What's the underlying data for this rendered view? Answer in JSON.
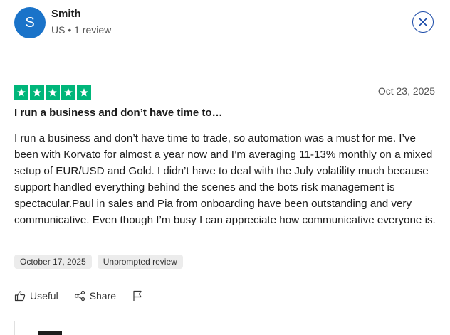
{
  "reviewer": {
    "initial": "S",
    "name": "Smith",
    "meta": "US • 1 review",
    "avatar_color": "#1a73c9"
  },
  "close": {
    "icon": "close-icon"
  },
  "review": {
    "rating": 5,
    "rating_max": 5,
    "star_color": "#00b67a",
    "date": "Oct 23, 2025",
    "title": "I run a business and don’t have time to…",
    "body": "I run a business and don’t have time to trade, so automation was a must for me. I’ve been with Korvato for almost a year now and I’m averaging 11-13% monthly on a mixed setup of EUR/USD and Gold. I didn’t have to deal with the July volatility much because support handled everything behind the scenes and the bots risk management is spectacular.Paul in sales and Pia from onboarding have been outstanding and very communicative. Even though I’m busy I can appreciate how communicative everyone is."
  },
  "tags": {
    "experience_date": "October 17, 2025",
    "review_type": "Unprompted review"
  },
  "actions": {
    "useful_label": "Useful",
    "share_label": "Share"
  }
}
